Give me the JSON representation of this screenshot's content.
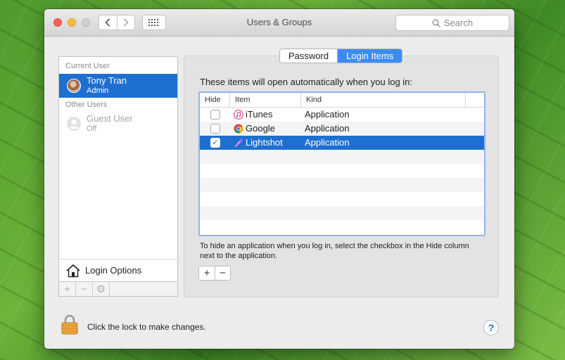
{
  "window": {
    "title": "Users & Groups"
  },
  "search": {
    "placeholder": "Search"
  },
  "sidebar": {
    "current_user_header": "Current User",
    "current_user": {
      "name": "Tony Tran",
      "role": "Admin"
    },
    "other_users_header": "Other Users",
    "other_users": [
      {
        "name": "Guest User",
        "role": "Off"
      }
    ],
    "login_options_label": "Login Options",
    "bottom_buttons": [
      "+",
      "−",
      "⚙"
    ]
  },
  "tabs": [
    {
      "label": "Password",
      "active": false
    },
    {
      "label": "Login Items",
      "active": true
    }
  ],
  "login_items": {
    "heading": "These items will open automatically when you log in:",
    "columns": [
      "Hide",
      "Item",
      "Kind"
    ],
    "rows": [
      {
        "hide": false,
        "icon": "itunes-icon",
        "item": "iTunes",
        "kind": "Application"
      },
      {
        "hide": false,
        "icon": "chrome-icon",
        "item": "Google",
        "kind": "Application"
      },
      {
        "hide": true,
        "icon": "lightshot-feather-icon",
        "item": "Lightshot",
        "kind": "Application"
      }
    ],
    "help_text": "To hide an application when you log in, select the checkbox in the Hide column next to the application.",
    "add_label": "+",
    "remove_label": "−"
  },
  "footer": {
    "lock_text": "Click the lock to make changes.",
    "help_label": "?"
  },
  "colors": {
    "selection": "#1e6fd0",
    "active_tab": "#3b8df6",
    "close": "#fc605c",
    "minimize": "#fdbc40"
  }
}
